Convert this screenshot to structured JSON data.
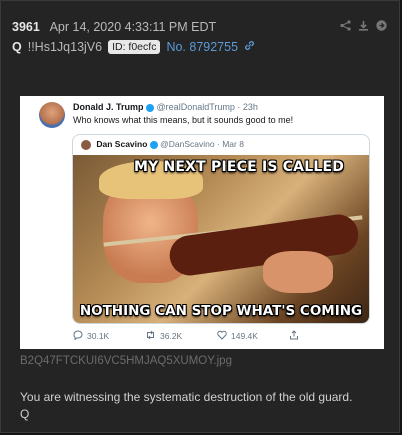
{
  "post": {
    "number": "3961",
    "datetime": "Apr 14, 2020 4:33:11 PM EDT",
    "author": "Q",
    "tripcode": "!!Hs1Jq13jV6",
    "id_badge": "ID: f0ecfc",
    "post_no": "No. 8792755",
    "icons": [
      "share-icon",
      "download-icon",
      "arrow-circle-icon",
      "link-icon"
    ]
  },
  "tweet": {
    "name": "Donald J. Trump",
    "handle": "@realDonaldTrump",
    "time": "· 23h",
    "text": "Who knows what this means, but it sounds good to me!",
    "quote": {
      "name": "Dan Scavino",
      "handle": "@DanScavino",
      "time": "· Mar 8",
      "meme_top": "MY NEXT PIECE IS CALLED",
      "meme_bottom": "NOTHING CAN STOP WHAT'S COMING"
    },
    "replies": "30.1K",
    "retweets": "36.2K",
    "likes": "149.4K"
  },
  "attachment": {
    "filename": "B2Q47FTCKUI6VC5HMJAQ5XUMOY.jpg"
  },
  "message": {
    "line1": "You are witnessing the systematic destruction of the old guard.",
    "line2": "Q"
  }
}
